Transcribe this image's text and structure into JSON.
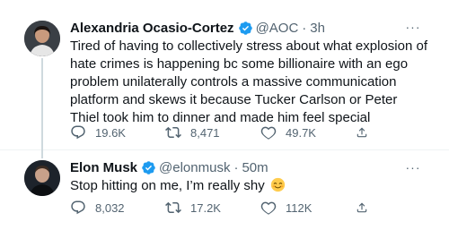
{
  "tweets": [
    {
      "name": "Alexandria Ocasio-Cortez",
      "handle": "@AOC",
      "separator": "·",
      "time": "3h",
      "text": "Tired of having to collectively stress about what explosion of hate crimes is happening bc some billionaire with an ego problem unilaterally controls a massive communication platform and skews it because Tucker Carlson or Peter Thiel took him to dinner and made him feel special",
      "replies": "19.6K",
      "retweets": "8,471",
      "likes": "49.7K",
      "more": "···"
    },
    {
      "name": "Elon Musk",
      "handle": "@elonmusk",
      "separator": "·",
      "time": "50m",
      "text": "Stop hitting on me, I’m really shy",
      "emoji": "blushing-face",
      "replies": "8,032",
      "retweets": "17.2K",
      "likes": "112K",
      "more": "···"
    }
  ],
  "colors": {
    "verified": "#1d9bf0",
    "muted": "#536471",
    "text": "#0f1419",
    "thread_line": "#cfd9de"
  },
  "icons": [
    "reply-icon",
    "retweet-icon",
    "like-icon",
    "share-icon",
    "more-icon",
    "verified-badge-icon"
  ]
}
